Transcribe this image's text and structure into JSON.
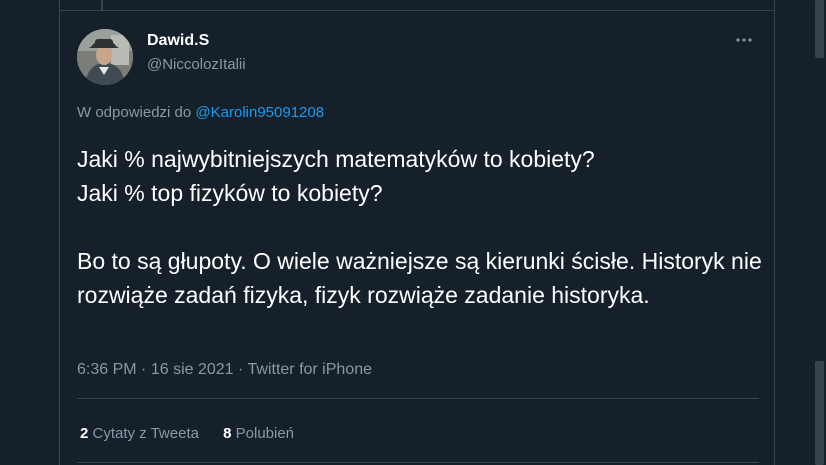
{
  "tweet": {
    "author": {
      "display_name": "Dawid.S",
      "handle": "@NiccolozItalii"
    },
    "reply_context": {
      "prefix": "W odpowiedzi do",
      "mention": "@Karolin95091208"
    },
    "text": "Jaki % najwybitniejszych matematyków to kobiety?\nJaki % top fizyków to kobiety?\n\nBo to są głupoty. O wiele ważniejsze są kierunki ścisłe. Historyk nie rozwiąże zadań fizyka, fizyk rozwiąże zadanie historyka.",
    "meta": {
      "time": "6:36 PM",
      "date": "16 sie 2021",
      "source": "Twitter for iPhone",
      "separator": "·"
    },
    "stats": {
      "quotes_count": "2",
      "quotes_label": "Cytaty z Tweeta",
      "likes_count": "8",
      "likes_label": "Polubień"
    },
    "more_icon": "more-horizontal-icon"
  },
  "colors": {
    "background": "#15202b",
    "border": "#38444d",
    "text_primary": "#ffffff",
    "text_secondary": "#8899a6",
    "accent": "#1d9bf0"
  }
}
